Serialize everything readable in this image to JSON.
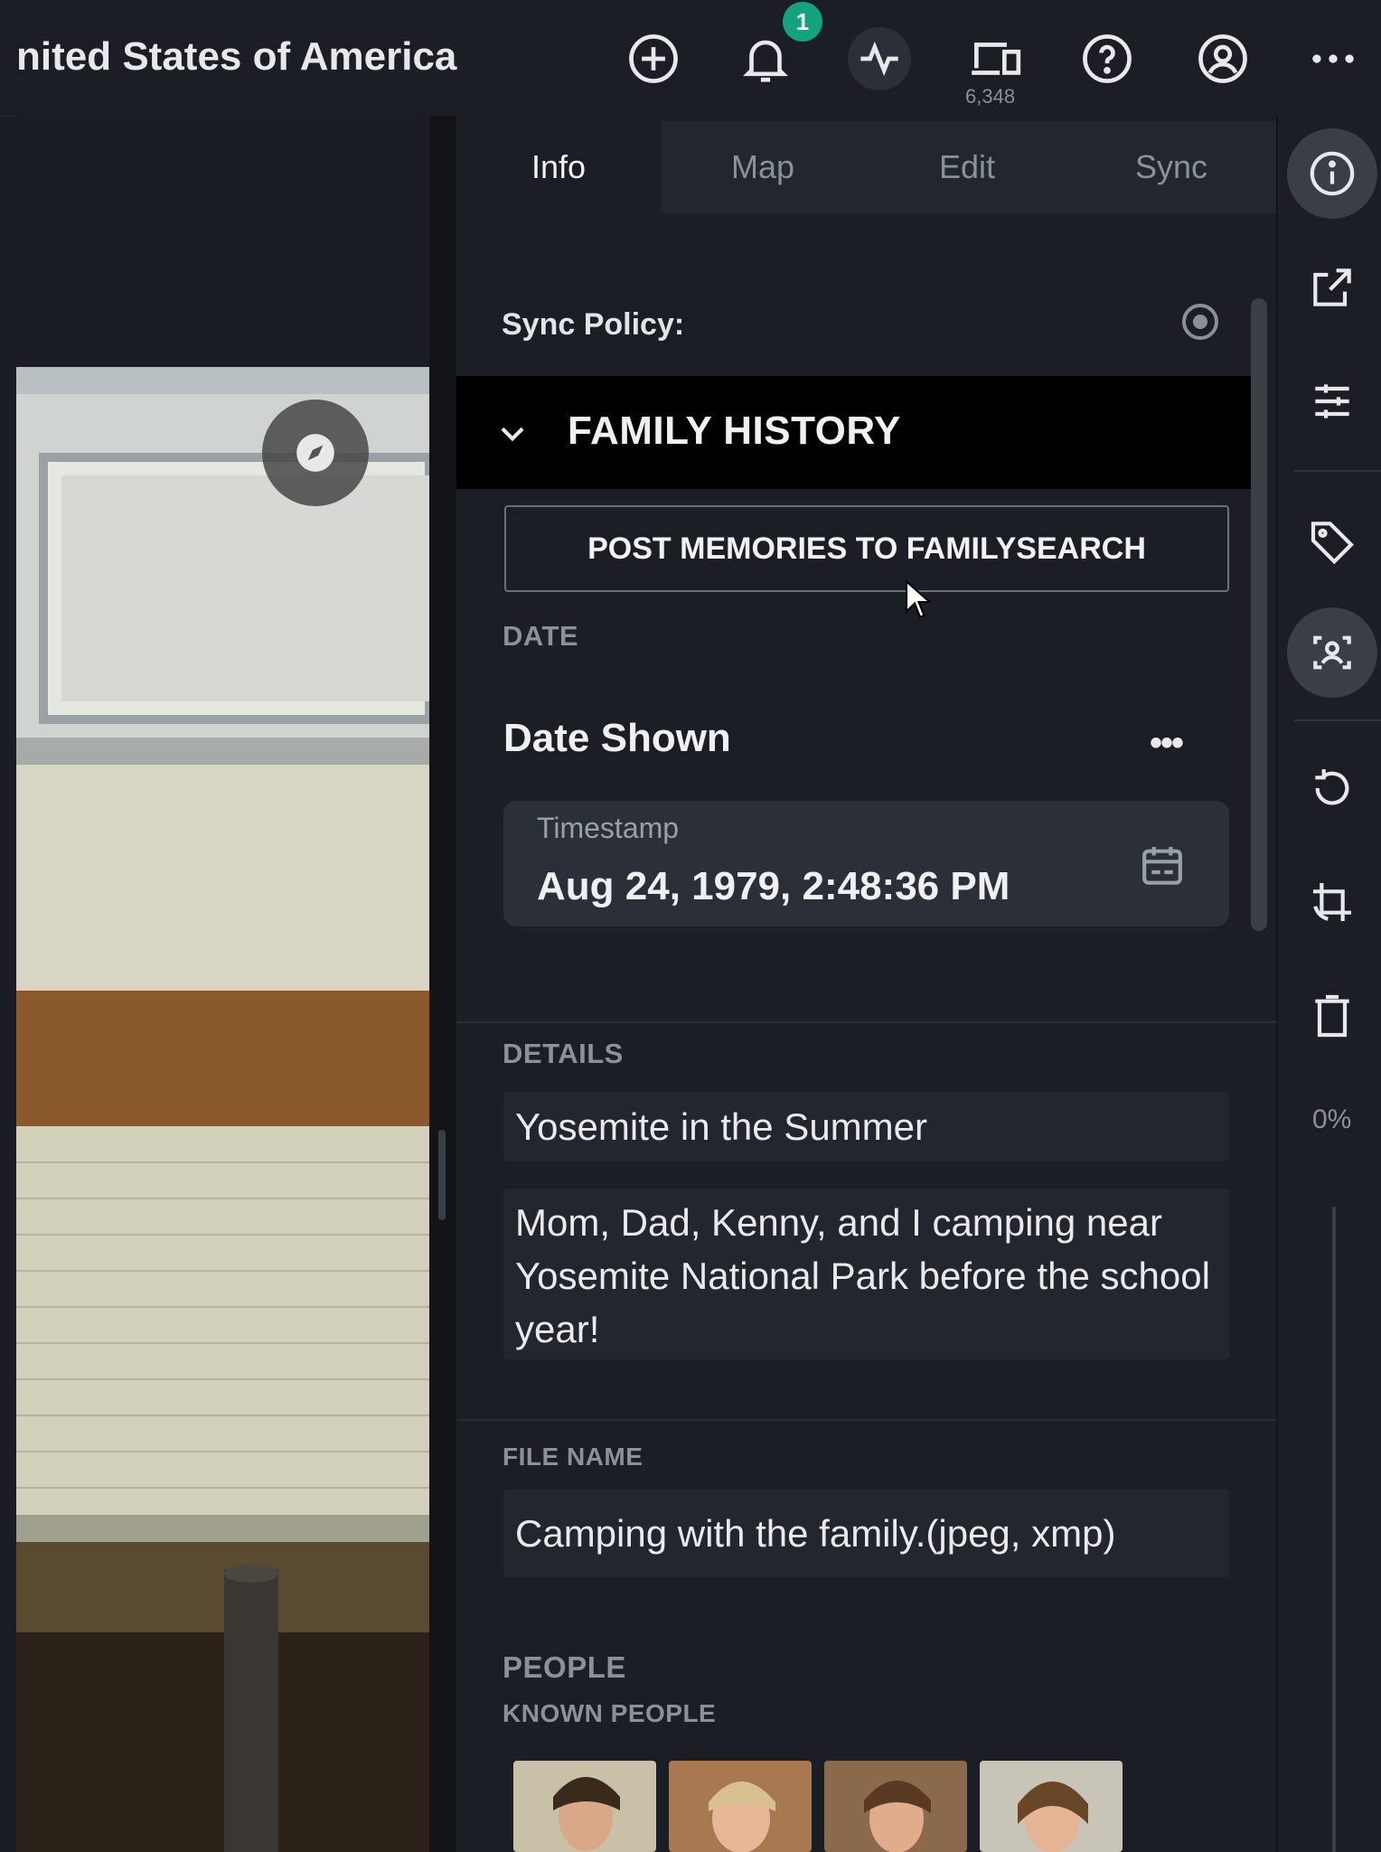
{
  "header": {
    "title": "nited States of America",
    "notification_count": "1",
    "device_count": "6,348",
    "icons": [
      "add-circle-icon",
      "bell-icon",
      "activity-icon",
      "devices-icon",
      "help-icon",
      "account-icon",
      "more-icon"
    ]
  },
  "tabs": [
    {
      "label": "Info",
      "active": true
    },
    {
      "label": "Map",
      "active": false
    },
    {
      "label": "Edit",
      "active": false
    },
    {
      "label": "Sync",
      "active": false
    }
  ],
  "sync_policy": {
    "label": "Sync Policy:"
  },
  "family_history": {
    "title": "FAMILY HISTORY",
    "post_button": "POST MEMORIES TO FAMILYSEARCH"
  },
  "date": {
    "section_label": "DATE",
    "heading": "Date Shown",
    "more": "•••",
    "timestamp_label": "Timestamp",
    "timestamp_value": "Aug 24, 1979, 2:48:36 PM"
  },
  "details": {
    "section_label": "DETAILS",
    "title": "Yosemite in the Summer",
    "description": "Mom, Dad, Kenny, and I camping near Yosemite National Park before the school year!"
  },
  "file": {
    "section_label": "FILE NAME",
    "name": "Camping with the family.(jpeg, xmp)"
  },
  "people": {
    "section_label": "PEOPLE",
    "sub_label": "KNOWN PEOPLE",
    "count": 4
  },
  "right_toolbar": {
    "zoom_percent": "0%",
    "icons": [
      "info-icon",
      "open-external-icon",
      "adjustments-icon",
      "tag-icon",
      "face-recognition-icon",
      "rotate-icon",
      "crop-rotate-icon",
      "trash-icon"
    ]
  },
  "colors": {
    "background": "#1b1e24",
    "badge": "#13a37f",
    "header_bar": "#000000"
  }
}
